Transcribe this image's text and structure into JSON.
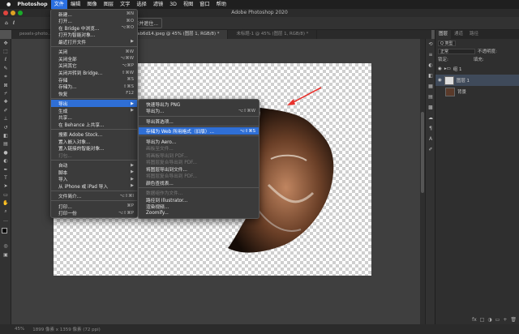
{
  "menubar": {
    "app": "Photoshop",
    "items": [
      "文件",
      "编辑",
      "图像",
      "图层",
      "文字",
      "选择",
      "滤镜",
      "3D",
      "视图",
      "窗口",
      "帮助"
    ]
  },
  "window_title": "Adobe Photoshop 2020",
  "options": {
    "button": "选择并遮住..."
  },
  "tabs": [
    "pexels-photo...",
    "photo-1509695603202-4d89aeab6d14.jpeg @ 45% (图层 1, RGB/8) *",
    "未标题-1 @ 45% (图层 1, RGB/8) *"
  ],
  "file_menu": [
    {
      "label": "新建...",
      "shortcut": "⌘N"
    },
    {
      "label": "打开...",
      "shortcut": "⌘O"
    },
    {
      "label": "在 Bridge 中浏览...",
      "shortcut": "⌥⌘O"
    },
    {
      "label": "打开为智能对象..."
    },
    {
      "label": "最近打开文件",
      "arrow": "▶"
    },
    {
      "sep": true
    },
    {
      "label": "关闭",
      "shortcut": "⌘W"
    },
    {
      "label": "关闭全部",
      "shortcut": "⌥⌘W"
    },
    {
      "label": "关闭其它",
      "shortcut": "⌥⌘P"
    },
    {
      "label": "关闭并转到 Bridge...",
      "shortcut": "⇧⌘W"
    },
    {
      "label": "存储",
      "shortcut": "⌘S"
    },
    {
      "label": "存储为...",
      "shortcut": "⇧⌘S"
    },
    {
      "label": "恢复",
      "shortcut": "F12"
    },
    {
      "sep": true
    },
    {
      "label": "导出",
      "arrow": "▶",
      "state": "hi"
    },
    {
      "label": "生成",
      "arrow": "▶"
    },
    {
      "label": "共享..."
    },
    {
      "label": "在 Behance 上共享..."
    },
    {
      "sep": true
    },
    {
      "label": "搜索 Adobe Stock..."
    },
    {
      "label": "置入嵌入对象..."
    },
    {
      "label": "置入链接的智能对象..."
    },
    {
      "label": "打包...",
      "state": "dis"
    },
    {
      "sep": true
    },
    {
      "label": "自动",
      "arrow": "▶"
    },
    {
      "label": "脚本",
      "arrow": "▶"
    },
    {
      "label": "导入",
      "arrow": "▶"
    },
    {
      "label": "从 iPhone 或 iPad 导入",
      "arrow": "▶"
    },
    {
      "sep": true
    },
    {
      "label": "文件简介...",
      "shortcut": "⌥⇧⌘I"
    },
    {
      "sep": true
    },
    {
      "label": "打印...",
      "shortcut": "⌘P"
    },
    {
      "label": "打印一份",
      "shortcut": "⌥⇧⌘P"
    }
  ],
  "export_menu": [
    {
      "label": "快速导出为 PNG"
    },
    {
      "label": "导出为...",
      "shortcut": "⌥⇧⌘W"
    },
    {
      "sep": true
    },
    {
      "label": "导出首选项..."
    },
    {
      "sep": true
    },
    {
      "label": "存储为 Web 所用格式（旧版）...",
      "shortcut": "⌥⇧⌘S",
      "state": "hi"
    },
    {
      "sep": true
    },
    {
      "label": "导出为 Aero..."
    },
    {
      "label": "画板至文件...",
      "state": "dis"
    },
    {
      "label": "将画板导出到 PDF...",
      "state": "dis"
    },
    {
      "label": "将图层复合导出到 PDF...",
      "state": "dis"
    },
    {
      "label": "将图层导出到文件..."
    },
    {
      "label": "将图层复合导出到 PDF...",
      "state": "dis"
    },
    {
      "label": "颜色查找表..."
    },
    {
      "sep": true
    },
    {
      "label": "数据组作为文件...",
      "state": "dis"
    },
    {
      "label": "路径到 Illustrator..."
    },
    {
      "label": "渲染视频..."
    },
    {
      "label": "Zoomify..."
    }
  ],
  "panel": {
    "tabs": [
      "图层",
      "通道",
      "路径"
    ],
    "kind": "Q 类型",
    "blend": "正常",
    "opacity": "不透明度:",
    "lock": "锁定:",
    "fill": "填充:",
    "layers": [
      {
        "name": "组 1",
        "type": "group"
      },
      {
        "name": "图层 1",
        "type": "layer",
        "selected": true
      },
      {
        "name": "背景",
        "type": "bg"
      }
    ],
    "bottom_icons": [
      "fx",
      "□",
      "◑",
      "▭",
      "+",
      "🗑"
    ]
  },
  "status": {
    "zoom": "45%",
    "info": "1899 像素 x 1359 像素 (72 ppi)"
  },
  "colors": {
    "highlight": "#2f6fd6",
    "arrow": "#e8322d"
  }
}
